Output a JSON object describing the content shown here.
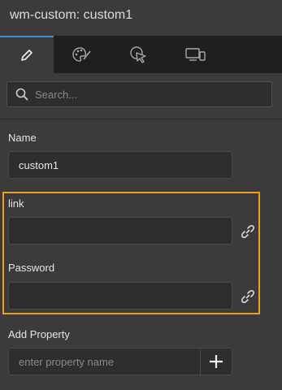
{
  "panel": {
    "title": "wm-custom: custom1"
  },
  "tabs": [
    {
      "icon": "pencil-icon",
      "active": true
    },
    {
      "icon": "palette-icon",
      "active": false
    },
    {
      "icon": "cursor-click-icon",
      "active": false
    },
    {
      "icon": "devices-icon",
      "active": false
    }
  ],
  "search": {
    "placeholder": "Search..."
  },
  "properties": {
    "name": {
      "label": "Name",
      "value": "custom1"
    },
    "link": {
      "label": "link",
      "value": ""
    },
    "password": {
      "label": "Password",
      "value": ""
    }
  },
  "add_property": {
    "label": "Add Property",
    "placeholder": "enter property name"
  },
  "colors": {
    "accent": "#3a8fd9",
    "highlight": "#f0a020",
    "background": "#3b3b3b",
    "tabbar": "#1f1f1f"
  }
}
